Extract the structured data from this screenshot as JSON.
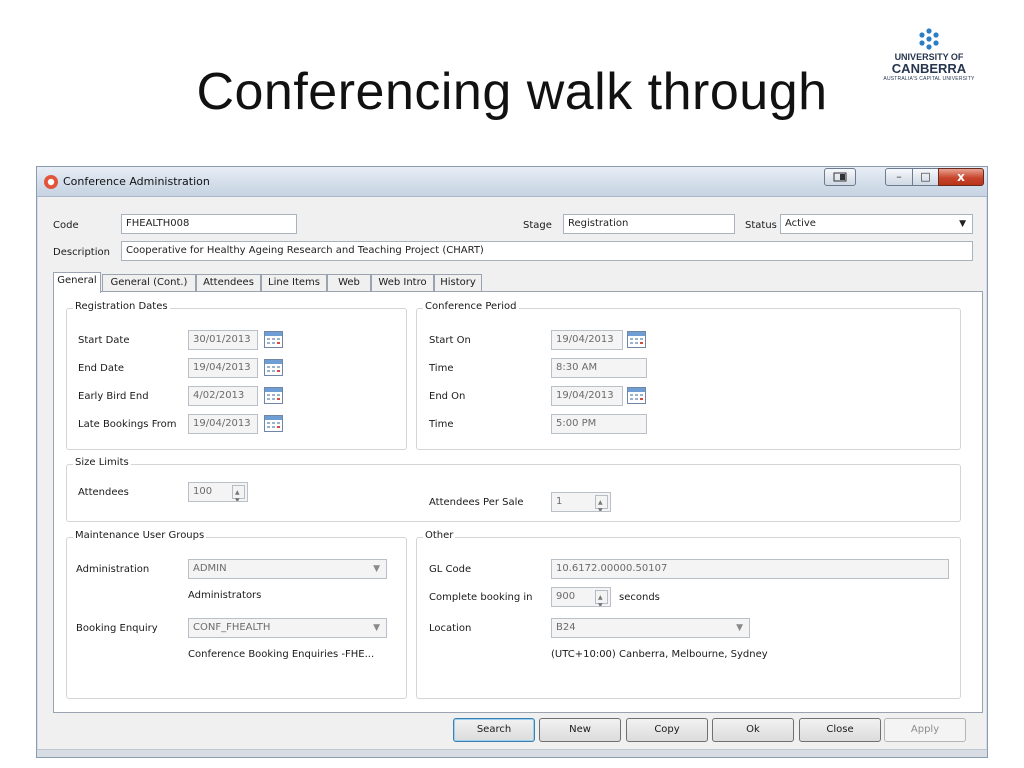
{
  "slide": {
    "title": "Conferencing walk through",
    "logo": {
      "line1": "UNIVERSITY OF",
      "line2": "CANBERRA",
      "line3": "AUSTRALIA'S CAPITAL UNIVERSITY"
    }
  },
  "window": {
    "title": "Conference Administration",
    "close_glyph": "x",
    "min_glyph": "–",
    "max_glyph": "□"
  },
  "header": {
    "code_label": "Code",
    "code_value": "FHEALTH008",
    "stage_label": "Stage",
    "stage_value": "Registration",
    "status_label": "Status",
    "status_value": "Active",
    "description_label": "Description",
    "description_value": "Cooperative for Healthy Ageing Research and Teaching Project (CHART)"
  },
  "tabs": [
    {
      "label": "General",
      "active": true
    },
    {
      "label": "General (Cont.)"
    },
    {
      "label": "Attendees"
    },
    {
      "label": "Line Items"
    },
    {
      "label": "Web"
    },
    {
      "label": "Web Intro"
    },
    {
      "label": "History"
    }
  ],
  "registration": {
    "title": "Registration Dates",
    "start_label": "Start Date",
    "start_value": "30/01/2013",
    "end_label": "End Date",
    "end_value": "19/04/2013",
    "early_label": "Early Bird End",
    "early_value": "4/02/2013",
    "late_label": "Late Bookings From",
    "late_value": "19/04/2013"
  },
  "period": {
    "title": "Conference Period",
    "start_label": "Start On",
    "start_value": "19/04/2013",
    "time1_label": "Time",
    "time1_value": "8:30 AM",
    "end_label": "End On",
    "end_value": "19/04/2013",
    "time2_label": "Time",
    "time2_value": "5:00 PM"
  },
  "size": {
    "title": "Size Limits",
    "attendees_label": "Attendees",
    "attendees_value": "100",
    "per_sale_label": "Attendees Per Sale",
    "per_sale_value": "1"
  },
  "maint": {
    "title": "Maintenance User Groups",
    "admin_label": "Administration",
    "admin_value": "ADMIN",
    "admin_desc": "Administrators",
    "enquiry_label": "Booking Enquiry",
    "enquiry_value": "CONF_FHEALTH",
    "enquiry_desc": "Conference Booking Enquiries -FHE..."
  },
  "other": {
    "title": "Other",
    "gl_label": "GL Code",
    "gl_value": "10.6172.00000.50107",
    "complete_label": "Complete booking in",
    "complete_value": "900",
    "complete_unit": "seconds",
    "location_label": "Location",
    "location_value": "B24",
    "timezone": "(UTC+10:00) Canberra, Melbourne, Sydney"
  },
  "buttons": {
    "search": "Search",
    "new": "New",
    "copy": "Copy",
    "ok": "Ok",
    "close": "Close",
    "apply": "Apply"
  }
}
